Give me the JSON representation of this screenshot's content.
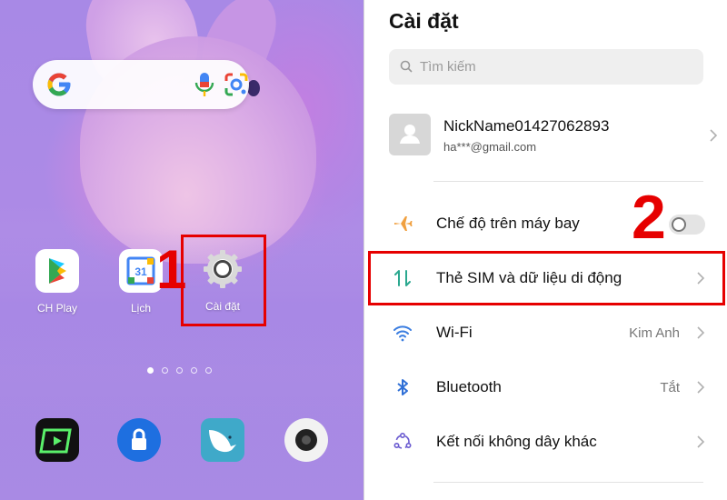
{
  "home": {
    "apps": [
      {
        "label": "CH Play",
        "icon": "play-store-icon"
      },
      {
        "label": "Lịch",
        "icon": "calendar-icon",
        "badge": "31"
      },
      {
        "label": "Cài đặt",
        "icon": "settings-gear-icon"
      }
    ],
    "page_indicator": {
      "count": 5,
      "active": 1
    },
    "dock": [
      "tv-app-icon",
      "lock-app-icon",
      "bird-app-icon",
      "camera-app-icon"
    ],
    "step_label": "1"
  },
  "settings": {
    "title": "Cài đặt",
    "search_placeholder": "Tìm kiếm",
    "account": {
      "name": "NickName01427062893",
      "email": "ha***@gmail.com"
    },
    "step_label": "2",
    "rows": [
      {
        "label": "Chế độ trên máy bay",
        "icon": "airplane-icon",
        "value": "",
        "control": "toggle",
        "toggle_on": false
      },
      {
        "label": "Thẻ SIM và dữ liệu di động",
        "icon": "sim-data-icon",
        "value": "",
        "control": "chevron"
      },
      {
        "label": "Wi-Fi",
        "icon": "wifi-icon",
        "value": "Kim Anh",
        "control": "chevron"
      },
      {
        "label": "Bluetooth",
        "icon": "bluetooth-icon",
        "value": "Tắt",
        "control": "chevron"
      },
      {
        "label": "Kết nối không dây khác",
        "icon": "connections-icon",
        "value": "",
        "control": "chevron"
      }
    ]
  },
  "colors": {
    "highlight": "#e60000",
    "airplane": "#f0a040",
    "sim": "#2ba88f",
    "wifi": "#3a7de0",
    "bluetooth": "#2f6fd6",
    "connections": "#6a5ad0"
  }
}
